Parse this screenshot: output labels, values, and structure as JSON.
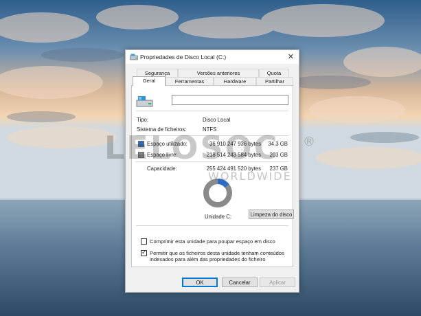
{
  "window": {
    "title": "Propriedades de Disco Local (C:)",
    "close_glyph": "✕",
    "icon": "drive-properties-icon"
  },
  "tabs_row1": [
    {
      "label": "Segurança"
    },
    {
      "label": "Versões anteriores"
    },
    {
      "label": "Quota"
    }
  ],
  "tabs_row2": [
    {
      "label": "Geral",
      "active": true
    },
    {
      "label": "Ferramentas"
    },
    {
      "label": "Hardware"
    },
    {
      "label": "Partilhar"
    }
  ],
  "general": {
    "drive_icon": "drive-icon",
    "name_value": "",
    "type_label": "Tipo:",
    "type_value": "Disco Local",
    "fs_label": "Sistema de ficheiros:",
    "fs_value": "NTFS",
    "used_label": "Espaço utilizado:",
    "used_bytes": "36 910 247 936 bytes",
    "used_gb": "34,3 GB",
    "free_label": "Espaço livre:",
    "free_bytes": "218 514 243 584 bytes",
    "free_gb": "203 GB",
    "capacity_label": "Capacidade:",
    "capacity_bytes": "255 424 491 520 bytes",
    "capacity_gb": "237 GB",
    "used_fraction": 0.1445,
    "used_color": "#2b6cc4",
    "free_color": "#8a8a8a",
    "drive_label": "Unidade C:",
    "cleanup_button": "Limpeza do disco",
    "compress_label": "Comprimir esta unidade para poupar espaço em disco",
    "compress_checked": false,
    "index_label_line1": "Permitir que os ficheiros desta unidade tenham conteúdos",
    "index_label_line2": "indexados para além das propriedades do ficheiro",
    "index_checked": true
  },
  "buttons": {
    "ok": "OK",
    "cancel": "Cancelar",
    "apply": "Aplicar"
  },
  "watermark": {
    "main": "LELOSOC",
    "sub": "WORLDWIDE",
    "reg": "®"
  }
}
